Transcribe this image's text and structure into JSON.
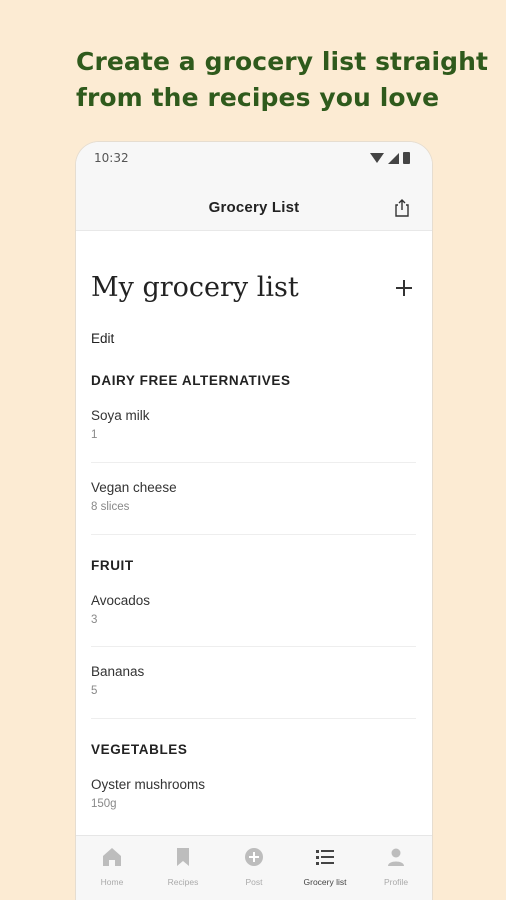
{
  "headline": {
    "line1": "Create a grocery list straight",
    "line2": "from the recipes you love"
  },
  "status": {
    "time": "10:32"
  },
  "appbar": {
    "title": "Grocery List",
    "share_icon": "share-icon"
  },
  "list": {
    "title": "My grocery list",
    "add_icon": "plus-icon",
    "edit_label": "Edit",
    "sections": [
      {
        "name": "DAIRY FREE ALTERNATIVES",
        "items": [
          {
            "name": "Soya milk",
            "qty": "1"
          },
          {
            "name": "Vegan cheese",
            "qty": "8 slices"
          }
        ]
      },
      {
        "name": "FRUIT",
        "items": [
          {
            "name": "Avocados",
            "qty": "3"
          },
          {
            "name": "Bananas",
            "qty": "5"
          }
        ]
      },
      {
        "name": "VEGETABLES",
        "items": [
          {
            "name": "Oyster mushrooms",
            "qty": "150g"
          }
        ]
      }
    ]
  },
  "nav": {
    "items": [
      {
        "label": "Home",
        "icon": "home-icon"
      },
      {
        "label": "Recipes",
        "icon": "bookmark-icon"
      },
      {
        "label": "Post",
        "icon": "plus-circle-icon"
      },
      {
        "label": "Grocery list",
        "icon": "list-icon",
        "active": true
      },
      {
        "label": "Profile",
        "icon": "person-icon"
      }
    ]
  }
}
